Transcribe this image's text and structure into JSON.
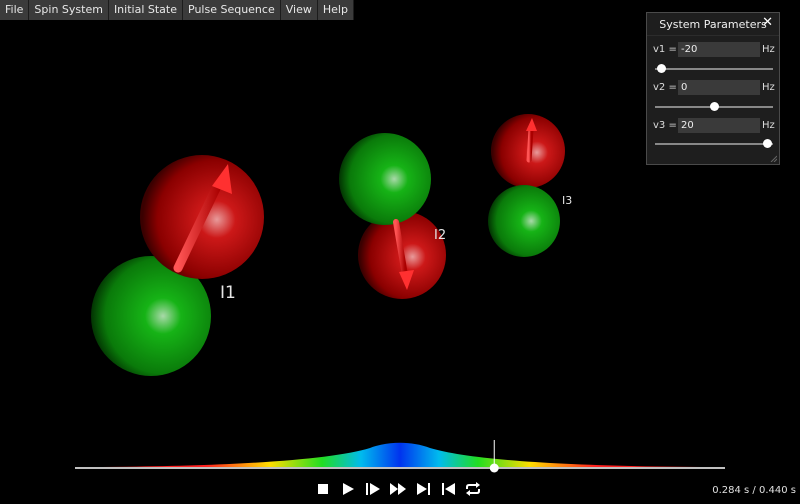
{
  "menu": [
    {
      "label": "File"
    },
    {
      "label": "Spin System"
    },
    {
      "label": "Initial State"
    },
    {
      "label": "Pulse Sequence"
    },
    {
      "label": "View"
    },
    {
      "label": "Help"
    }
  ],
  "scene": {
    "spins": [
      {
        "label": "I1"
      },
      {
        "label": "I2"
      },
      {
        "label": "I3"
      }
    ],
    "colors": {
      "sphere_red": "#cc1111",
      "sphere_green": "#11aa11",
      "arrow": "#ee2222"
    }
  },
  "panel": {
    "title": "System Parameters",
    "close_icon": "close-icon",
    "params": [
      {
        "label": "v1 =",
        "value": "-20",
        "unit": "Hz",
        "slider_fraction": 0.05
      },
      {
        "label": "v2 =",
        "value": "0",
        "unit": "Hz",
        "slider_fraction": 0.5
      },
      {
        "label": "v3 =",
        "value": "20",
        "unit": "Hz",
        "slider_fraction": 0.95
      }
    ]
  },
  "timeline": {
    "playhead_fraction": 0.645,
    "time_readout": "0.284 s / 0.440 s",
    "controls": [
      "stop-icon",
      "play-icon",
      "step-forward-icon",
      "fast-forward-icon",
      "skip-to-end-icon",
      "skip-to-start-icon",
      "loop-icon"
    ]
  }
}
